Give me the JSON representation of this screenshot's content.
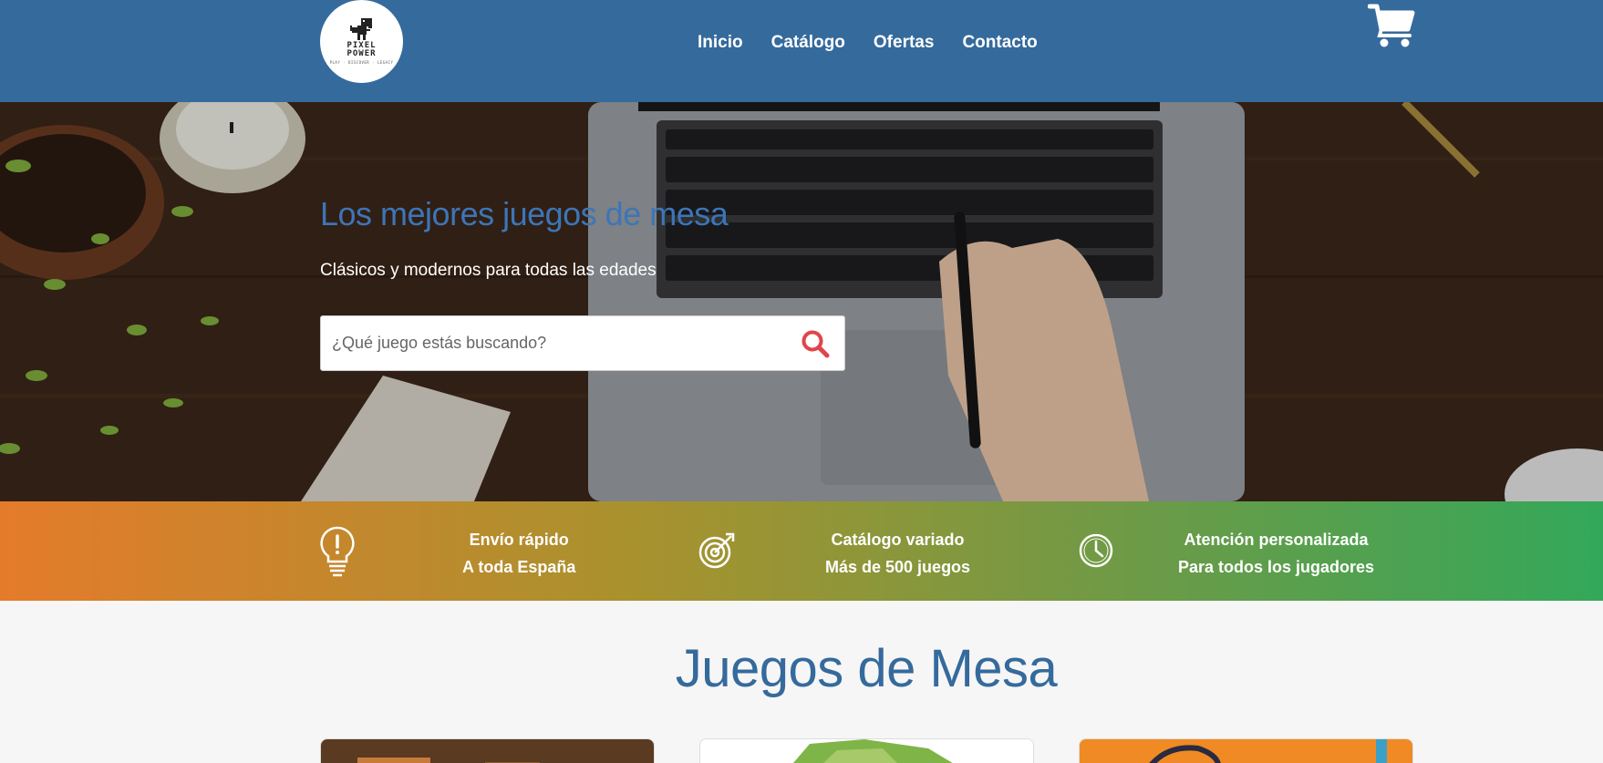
{
  "brand": {
    "logo_word_1": "PIXEL",
    "logo_word_2": "POWER",
    "logo_tagline": "PLAY · DISCOVER · LEGACY"
  },
  "nav": {
    "items": [
      {
        "label": "Inicio"
      },
      {
        "label": "Catálogo"
      },
      {
        "label": "Ofertas"
      },
      {
        "label": "Contacto"
      }
    ],
    "cart_icon": "cart-icon"
  },
  "hero": {
    "title": "Los mejores juegos de mesa",
    "subtitle": "Clásicos y modernos para todas las edades",
    "search": {
      "placeholder": "¿Qué juego estás buscando?",
      "value": "",
      "icon": "search-icon"
    }
  },
  "features": [
    {
      "icon": "lightbulb-icon",
      "line1": "Envío rápido",
      "line2": "A toda España"
    },
    {
      "icon": "target-icon",
      "line1": "Catálogo variado",
      "line2": "Más de 500 juegos"
    },
    {
      "icon": "clock-icon",
      "line1": "Atención personalizada",
      "line2": "Para todos los jugadores"
    }
  ],
  "catalog": {
    "title": "Juegos de Mesa"
  },
  "colors": {
    "navbar": "#356a9c",
    "hero_title": "#3d75b8",
    "search_icon": "#e0454a",
    "gradient_start": "#e47b2b",
    "gradient_end": "#33a85a"
  }
}
